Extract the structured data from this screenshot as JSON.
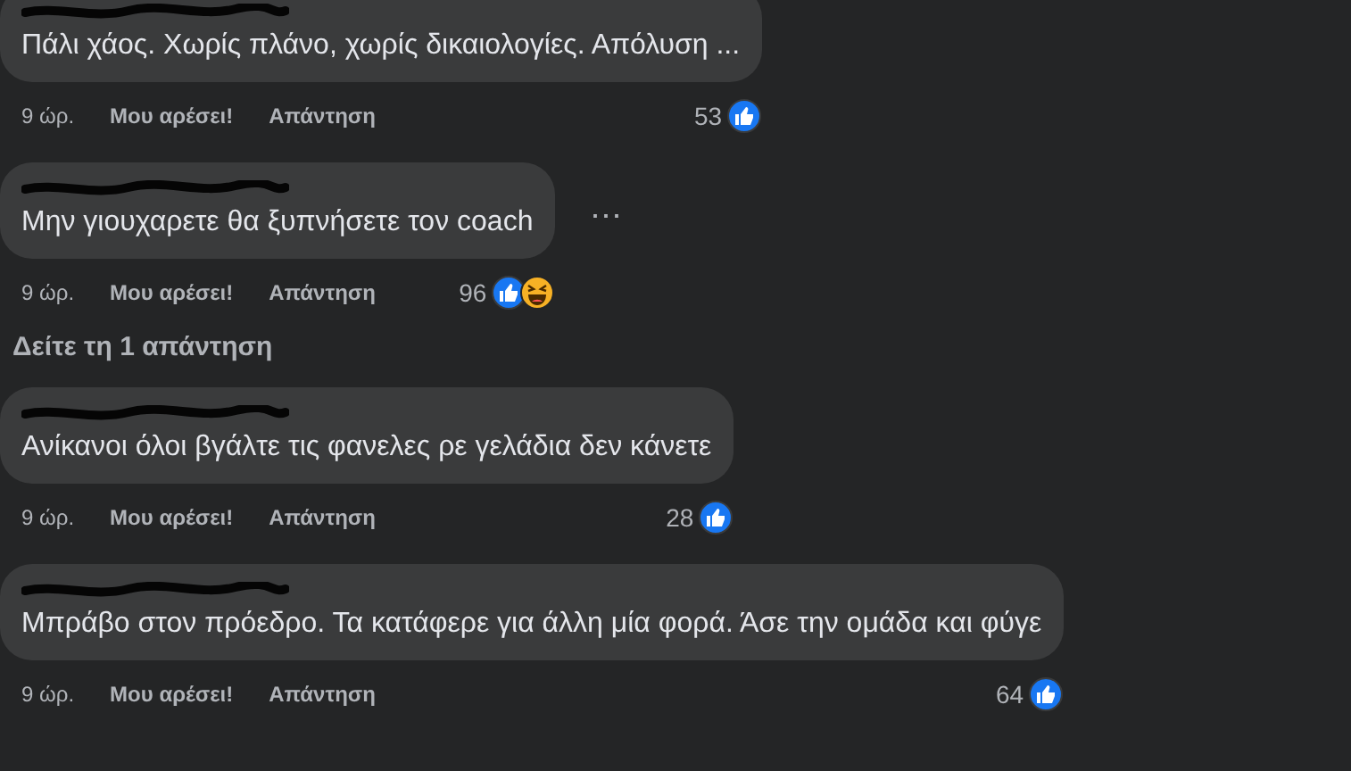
{
  "comments": [
    {
      "text": "Πάλι χάος. Χωρίς πλάνο, χωρίς δικαιολογίες. Απόλυση ...",
      "time": "9 ώρ.",
      "like": "Μου αρέσει!",
      "reply": "Απάντηση",
      "count": "53",
      "reactions": [
        {
          "kind": "like"
        }
      ]
    },
    {
      "text": "Μην γιουχαρετε θα ξυπνήσετε τον coach",
      "time": "9 ώρ.",
      "like": "Μου αρέσει!",
      "reply": "Απάντηση",
      "count": "96",
      "reactions": [
        {
          "kind": "like"
        },
        {
          "kind": "haha"
        }
      ],
      "menu": "⋯",
      "more_replies": "Δείτε τη 1 απάντηση"
    },
    {
      "text": "Ανίκανοι όλοι βγάλτε τις φανελες ρε γελάδια δεν κάνετε",
      "time": "9 ώρ.",
      "like": "Μου αρέσει!",
      "reply": "Απάντηση",
      "count": "28",
      "reactions": [
        {
          "kind": "like"
        }
      ]
    },
    {
      "text": "Μπράβο στον πρόεδρο. Τα κατάφερε για άλλη μία φορά. Άσε την ομάδα και φύγε",
      "time": "9 ώρ.",
      "like": "Μου αρέσει!",
      "reply": "Απάντηση",
      "count": "64",
      "reactions": [
        {
          "kind": "like"
        }
      ]
    }
  ]
}
